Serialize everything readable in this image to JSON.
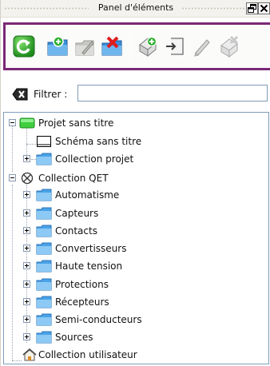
{
  "window": {
    "title": "Panel d'éléments"
  },
  "toolbar": {
    "buttons": [
      {
        "name": "reload-icon",
        "tooltip": ""
      },
      {
        "name": "new-category-icon",
        "tooltip": ""
      },
      {
        "name": "edit-category-icon",
        "tooltip": ""
      },
      {
        "name": "delete-category-icon",
        "tooltip": ""
      },
      {
        "name": "new-element-icon",
        "tooltip": ""
      },
      {
        "name": "import-element-icon",
        "tooltip": ""
      },
      {
        "name": "edit-element-icon",
        "tooltip": ""
      },
      {
        "name": "delete-element-icon",
        "tooltip": ""
      }
    ],
    "highlight_color": "#7a2877"
  },
  "filter": {
    "label": "Filtrer :",
    "value": "",
    "placeholder": ""
  },
  "tree": {
    "project": {
      "label": "Projet sans titre",
      "children": [
        {
          "label": "Schéma sans titre",
          "type": "schema"
        },
        {
          "label": "Collection projet",
          "type": "folder",
          "collapsed": true
        }
      ]
    },
    "qet_collection": {
      "label": "Collection QET",
      "children": [
        {
          "label": "Automatisme"
        },
        {
          "label": "Capteurs"
        },
        {
          "label": "Contacts"
        },
        {
          "label": "Convertisseurs"
        },
        {
          "label": "Haute tension"
        },
        {
          "label": "Protections"
        },
        {
          "label": "Récepteurs"
        },
        {
          "label": "Semi-conducteurs"
        },
        {
          "label": "Sources"
        }
      ]
    },
    "user_collection": {
      "label": "Collection utilisateur"
    }
  }
}
